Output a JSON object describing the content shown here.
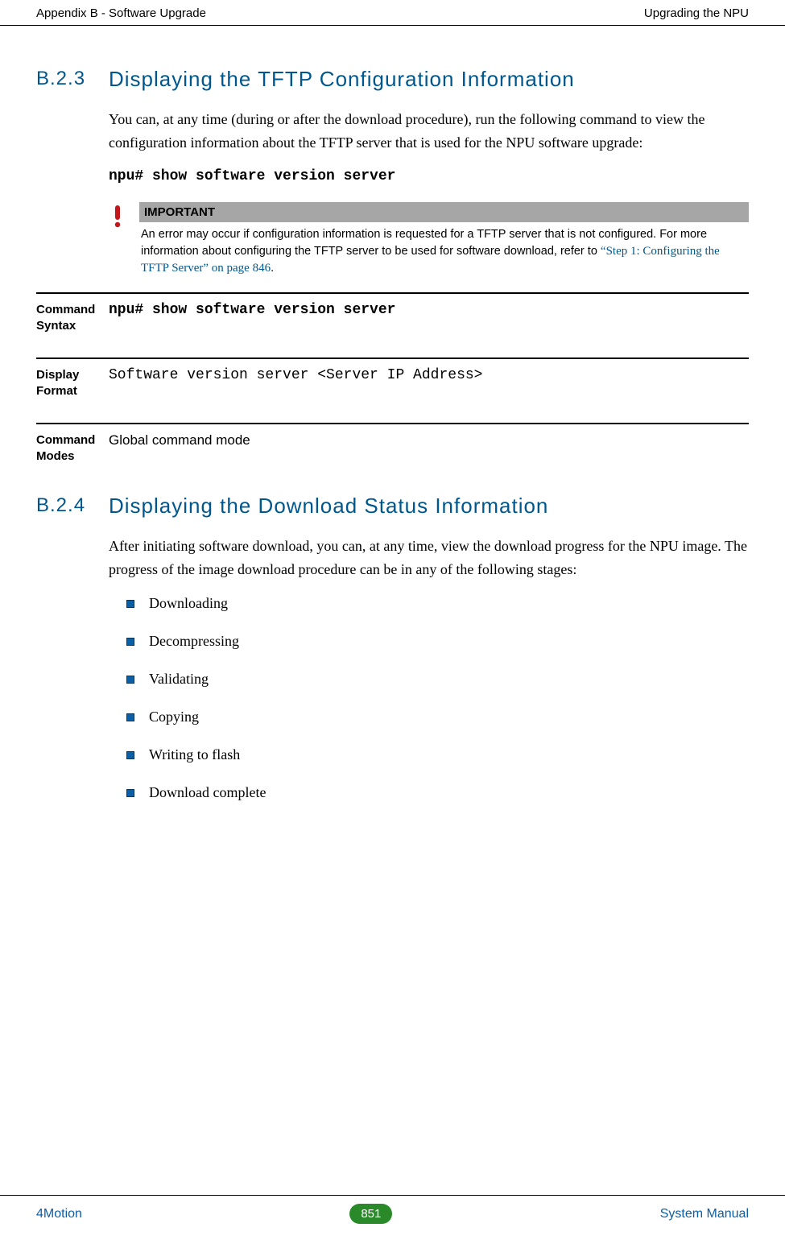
{
  "header": {
    "left": "Appendix B - Software Upgrade",
    "right": "Upgrading the NPU"
  },
  "section1": {
    "num": "B.2.3",
    "title": "Displaying the TFTP Configuration Information",
    "para": "You can, at any time (during or after the download procedure), run the following command to view the configuration information about the TFTP server that is used for the NPU software upgrade:",
    "command": "npu# show software version server"
  },
  "important": {
    "label": "IMPORTANT",
    "text": "An error may occur if configuration information is requested for a TFTP server that is not configured. For more information about configuring the TFTP server to be used for software download, refer to ",
    "link": "“Step 1: Configuring the TFTP Server” on page 846",
    "suffix": "."
  },
  "defs": {
    "syntax_label": "Command Syntax",
    "syntax_value": "npu# show software version server",
    "format_label": "Display Format",
    "format_value": "Software version server <Server IP Address>",
    "modes_label": "Command Modes",
    "modes_value": "Global command mode"
  },
  "section2": {
    "num": "B.2.4",
    "title": "Displaying the Download Status Information",
    "para": "After initiating software download, you can, at any time, view the download progress for the NPU image. The progress of the image download procedure can be in any of the following stages:",
    "bullets": [
      "Downloading",
      "Decompressing",
      "Validating",
      "Copying",
      "Writing to flash",
      "Download complete"
    ]
  },
  "footer": {
    "left": "4Motion",
    "page": "851",
    "right": "System Manual"
  }
}
